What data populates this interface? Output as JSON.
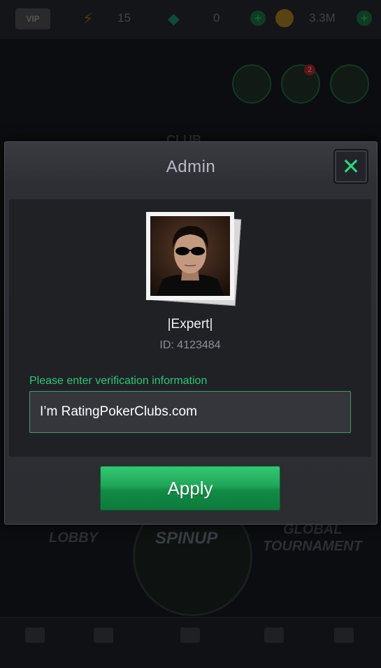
{
  "background": {
    "vip_label": "VIP",
    "energy_count": "15",
    "gems_count": "0",
    "coins": "3.3M",
    "notification_count": "2",
    "club_label": "CLUB",
    "lobby_label": "LOBBY",
    "spinup_label": "SPINUP",
    "global_label": "GLOBAL",
    "tournament_label": "TOURNAMENT"
  },
  "modal": {
    "title": "Admin",
    "player": {
      "name": "|Expert|",
      "id_text": "ID: 4123484"
    },
    "field_label": "Please enter verification information",
    "field_value": "I’m RatingPokerClubs.com",
    "apply_label": "Apply",
    "close_symbol": "✕"
  },
  "colors": {
    "accent_green": "#2cc874",
    "close_green": "#2bd67b",
    "modal_bg": "#2e2f34"
  }
}
